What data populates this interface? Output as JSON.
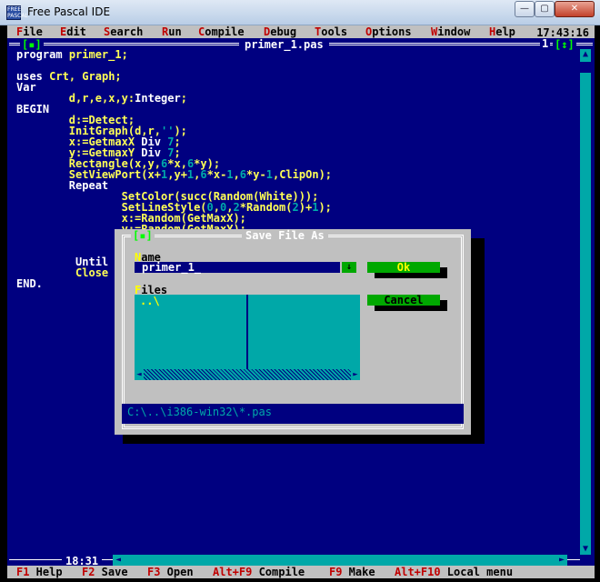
{
  "window": {
    "title": "Free Pascal IDE",
    "icon_text": "FREE PASCAL",
    "buttons": {
      "minimize": "—",
      "maximize": "▢",
      "close": "✕"
    }
  },
  "menu": {
    "items": [
      {
        "hk": "F",
        "rest": "ile"
      },
      {
        "hk": "E",
        "rest": "dit"
      },
      {
        "hk": "S",
        "rest": "earch"
      },
      {
        "hk": "R",
        "rest": "un"
      },
      {
        "hk": "C",
        "rest": "ompile"
      },
      {
        "hk": "D",
        "rest": "ebug"
      },
      {
        "hk": "T",
        "rest": "ools"
      },
      {
        "hk": "O",
        "rest": "ptions"
      },
      {
        "hk": "W",
        "rest": "indow"
      },
      {
        "hk": "H",
        "rest": "elp"
      }
    ],
    "clock": "17:43:16"
  },
  "editor": {
    "filename": "primer_1.pas",
    "close_box": "[▪]",
    "window_number": "1",
    "zoom_box": "[↕]",
    "cursor_position": "18:31",
    "code": [
      "program primer_1;",
      "",
      "uses Crt, Graph;",
      "Var",
      "        d,r,e,x,y:Integer;",
      "BEGIN",
      "        d:=Detect;",
      "        InitGraph(d,r,'');",
      "        x:=GetmaxX Div 7;",
      "        y:=GetmaxY Div 7;",
      "        Rectangle(x,y,6*x,6*y);",
      "        SetViewPort(x+1,y+1,6*x-1,6*y-1,ClipOn);",
      "        Repeat",
      "                SetColor(succ(Random(White)));",
      "                SetLineStyle(0,0,2*Random(2)+1);",
      "                x:=Random(GetMaxX);",
      "                y:=Random(GetMaxY);",
      "",
      "",
      "         Until",
      "         Close",
      "END."
    ]
  },
  "status": {
    "items": [
      {
        "key": "F1",
        "label": " Help"
      },
      {
        "key": "F2",
        "label": " Save"
      },
      {
        "key": "F3",
        "label": " Open"
      },
      {
        "key": "Alt+F9",
        "label": " Compile"
      },
      {
        "key": "F9",
        "label": " Make"
      },
      {
        "key": "Alt+F10",
        "label": " Local menu"
      }
    ]
  },
  "dialog": {
    "title": "Save File As",
    "close_box": "[▪]",
    "name_label_hk": "N",
    "name_label_rest": "ame",
    "name_value": "primer_1_",
    "history_button": "↓",
    "files_label_hk": "F",
    "files_label_rest": "iles",
    "files": [
      "..\\"
    ],
    "ok_label": "Ok",
    "cancel_label": "Cancel",
    "path": "C:\\..\\i386-win32\\*.pas",
    "scroll_left": "◄",
    "scroll_right": "►"
  }
}
